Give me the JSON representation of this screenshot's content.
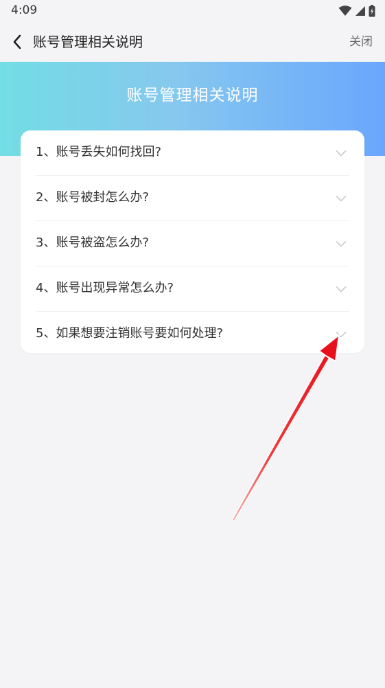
{
  "status_bar": {
    "time": "4:09"
  },
  "nav": {
    "title": "账号管理相关说明",
    "close_label": "关闭"
  },
  "banner": {
    "title": "账号管理相关说明"
  },
  "faq": {
    "items": [
      {
        "label": "1、账号丢失如何找回?"
      },
      {
        "label": "2、账号被封怎么办?"
      },
      {
        "label": "3、账号被盗怎么办?"
      },
      {
        "label": "4、账号出现异常怎么办?"
      },
      {
        "label": "5、如果想要注销账号要如何处理?"
      }
    ]
  },
  "colors": {
    "background": "#f4f4f6",
    "banner_start": "#72dde4",
    "banner_end": "#6aa6fd",
    "annotation_arrow": "#e8101a"
  },
  "icons": {
    "back": "chevron-left-icon",
    "expand": "chevron-down-icon",
    "wifi": "wifi-icon",
    "signal": "signal-icon",
    "battery": "battery-icon"
  }
}
